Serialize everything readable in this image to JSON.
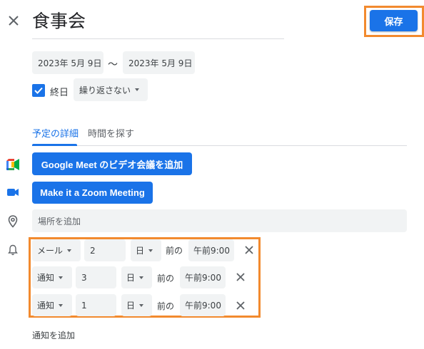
{
  "event": {
    "title": "食事会",
    "save_label": "保存"
  },
  "dates": {
    "start": "2023年 5月 9日",
    "separator": "〜",
    "end": "2023年 5月 9日"
  },
  "all_day": {
    "label": "終日",
    "checked": true,
    "repeat_value": "繰り返さない"
  },
  "tabs": [
    {
      "label": "予定の詳細",
      "active": true
    },
    {
      "label": "時間を探す",
      "active": false
    }
  ],
  "buttons": {
    "meet": "Google Meet のビデオ会議を追加",
    "zoom": "Make it a Zoom Meeting"
  },
  "location": {
    "placeholder": "場所を追加"
  },
  "notifications": [
    {
      "type": "メール",
      "amount": "2",
      "unit": "日",
      "relation": "前の",
      "time": "午前9:00"
    },
    {
      "type": "通知",
      "amount": "3",
      "unit": "日",
      "relation": "前の",
      "time": "午前9:00"
    },
    {
      "type": "通知",
      "amount": "1",
      "unit": "日",
      "relation": "前の",
      "time": "午前9:00"
    }
  ],
  "add_notification_label": "通知を追加",
  "colors": {
    "primary": "#1a73e8",
    "highlight": "#f28a2e",
    "field_bg": "#f1f3f4"
  },
  "icons": [
    "close-icon",
    "check-icon",
    "caret-down-icon",
    "google-meet-icon",
    "zoom-icon",
    "location-pin-icon",
    "bell-icon"
  ]
}
